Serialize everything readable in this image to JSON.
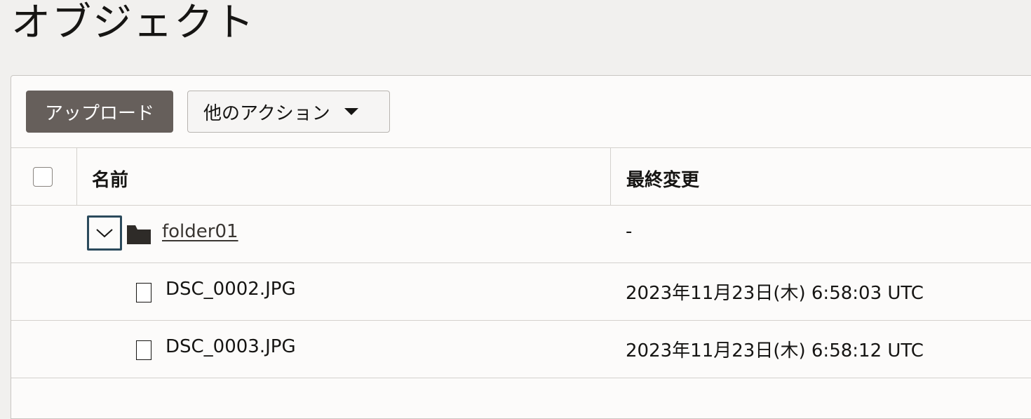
{
  "page": {
    "title": "オブジェクト"
  },
  "toolbar": {
    "upload_label": "アップロード",
    "more_actions_label": "他のアクション"
  },
  "table": {
    "columns": {
      "name": "名前",
      "last_modified": "最終変更"
    },
    "rows": [
      {
        "type": "folder",
        "name": "folder01",
        "last_modified": "-"
      },
      {
        "type": "file",
        "name": "DSC_0002.JPG",
        "last_modified": "2023年11月23日(木) 6:58:03 UTC"
      },
      {
        "type": "file",
        "name": "DSC_0003.JPG",
        "last_modified": "2023年11月23日(木) 6:58:12 UTC"
      }
    ]
  },
  "colors": {
    "primary_button": "#665f5b",
    "focus_outline": "#2b4a5c",
    "background": "#f1f0ee",
    "panel": "#fcfbfa"
  },
  "icons": {
    "dropdown": "caret-down-icon",
    "expand": "chevron-down-icon",
    "folder": "folder-icon",
    "file": "file-icon"
  }
}
